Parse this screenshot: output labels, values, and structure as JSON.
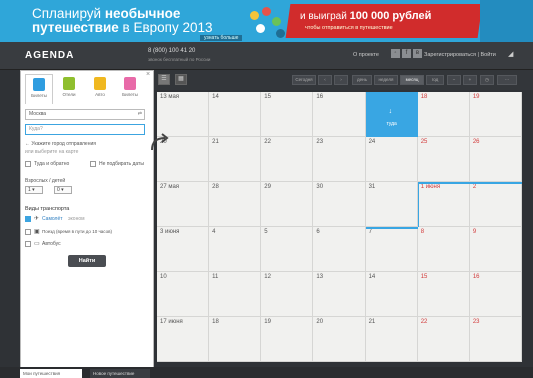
{
  "banner": {
    "line1_plain": "Спланируй ",
    "line1_bold": "необычное",
    "line2_bold": "путешествие",
    "line2_plain": " в Европу 2013",
    "sub": "узнать больше",
    "red_text_plain": "и выиграй ",
    "red_text_bold": "100 000 рублей",
    "red_sub": "чтобы отправиться в путешествие",
    "accent": "#2fa6d9",
    "red": "#d12c2c"
  },
  "header": {
    "logo": "AGENDA",
    "phone": "8 (800) 100 41 20",
    "phone_sub": "звонок бесплатный по России",
    "link_about": "О проекте",
    "user": "Зарегистрироваться | Войти"
  },
  "toolbar": {
    "today": "Сегодня",
    "days": "день",
    "weeks": "неделя",
    "month": "месяц",
    "year": "год"
  },
  "panel": {
    "tabs": [
      {
        "label": "Билеты",
        "color": "#2f9de0"
      },
      {
        "label": "Отели",
        "color": "#8fbf2e"
      },
      {
        "label": "Авто",
        "color": "#f0b820"
      },
      {
        "label": "Билеты",
        "color": "#e86aa8"
      }
    ],
    "from_value": "Москва",
    "from_switch": "⇄",
    "to_placeholder": "Куда?",
    "hint_plain": "← Укажите город ",
    "hint_link": "отправления",
    "hint_line2": "или выберите на карте",
    "option_roundtrip": "Туда и обратно",
    "option_dates": "Не подбирать даты",
    "passengers_label": "Взрослых / детей",
    "adults": "1",
    "children": "0",
    "transport_title": "Виды транспорта",
    "transport_items": [
      {
        "label": "Самолёт",
        "extra": "эконом",
        "checked": true
      },
      {
        "label": "Поезд (время в пути до 10 часов)",
        "extra": "",
        "checked": false
      },
      {
        "label": "Автобус",
        "extra": "",
        "checked": false
      }
    ],
    "find_button": "Найти"
  },
  "calendar": {
    "today_label": "туда",
    "rows": [
      [
        "13 мая",
        "14",
        "15",
        "16",
        "17 мая",
        "18",
        "19"
      ],
      [
        "20",
        "21",
        "22",
        "23",
        "24",
        "25",
        "26"
      ],
      [
        "27 мая",
        "28",
        "29",
        "30",
        "31",
        "1 июня",
        "2"
      ],
      [
        "3 июня",
        "4",
        "5",
        "6",
        "7",
        "8",
        "9"
      ],
      [
        "10",
        "11",
        "12",
        "13",
        "14",
        "15",
        "16"
      ],
      [
        "17 июня",
        "18",
        "19",
        "20",
        "21",
        "22",
        "23"
      ]
    ]
  },
  "bottom": {
    "box1": "Мои путешествия",
    "box2": "Новое путешествие"
  }
}
